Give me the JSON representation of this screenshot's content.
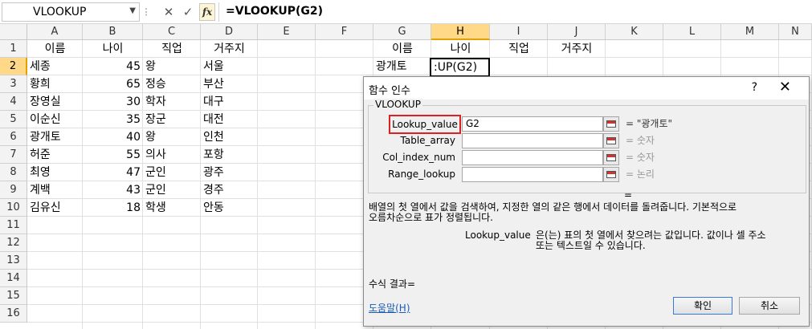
{
  "formula_bar": {
    "name_box": "VLOOKUP",
    "fx_label": "fx",
    "formula": "=VLOOKUP(G2)"
  },
  "columns": [
    "A",
    "B",
    "C",
    "D",
    "E",
    "F",
    "G",
    "H",
    "I",
    "J",
    "K",
    "L",
    "M",
    "N"
  ],
  "rows": [
    "1",
    "2",
    "3",
    "4",
    "5",
    "6",
    "7",
    "8",
    "9",
    "10",
    "11",
    "12",
    "13",
    "14",
    "15",
    "16"
  ],
  "headers": {
    "a": "이름",
    "b": "나이",
    "c": "직업",
    "d": "거주지",
    "g": "이름",
    "h": "나이",
    "i": "직업",
    "j": "거주지"
  },
  "data_rows": [
    {
      "name": "세종",
      "age": "45",
      "job": "왕",
      "city": "서울"
    },
    {
      "name": "황희",
      "age": "65",
      "job": "정승",
      "city": "부산"
    },
    {
      "name": "장영실",
      "age": "30",
      "job": "학자",
      "city": "대구"
    },
    {
      "name": "이순신",
      "age": "35",
      "job": "장군",
      "city": "대전"
    },
    {
      "name": "광개토",
      "age": "40",
      "job": "왕",
      "city": "인천"
    },
    {
      "name": "허준",
      "age": "55",
      "job": "의사",
      "city": "포항"
    },
    {
      "name": "최영",
      "age": "47",
      "job": "군인",
      "city": "광주"
    },
    {
      "name": "계백",
      "age": "43",
      "job": "군인",
      "city": "경주"
    },
    {
      "name": "김유신",
      "age": "18",
      "job": "학생",
      "city": "안동"
    }
  ],
  "g2": "광개토",
  "h2_edit": ":UP(G2)",
  "dialog": {
    "title": "함수 인수",
    "help_q": "?",
    "close": "✕",
    "function_name": "VLOOKUP",
    "args": [
      {
        "label": "Lookup_value",
        "value": "G2",
        "result": "= \"광개토\""
      },
      {
        "label": "Table_array",
        "value": "",
        "result": "= 숫자"
      },
      {
        "label": "Col_index_num",
        "value": "",
        "result": "= 숫자"
      },
      {
        "label": "Range_lookup",
        "value": "",
        "result": "= 논리"
      }
    ],
    "eq_line": "=",
    "description_1": "배열의 첫 열에서 값을 검색하여, 지정한 열의 같은 행에서 데이터를 돌려줍니다. 기본적으로",
    "description_2": "오름차순으로 표가 정렬됩니다.",
    "arg_help_name": "Lookup_value",
    "arg_help_1": "은(는) 표의 첫 열에서 찾으려는 값입니다. 값이나 셀 주소",
    "arg_help_2": "또는 텍스트일 수 있습니다.",
    "formula_result": "수식 결과=",
    "help_link": "도움말(H)",
    "ok": "확인",
    "cancel": "취소"
  }
}
